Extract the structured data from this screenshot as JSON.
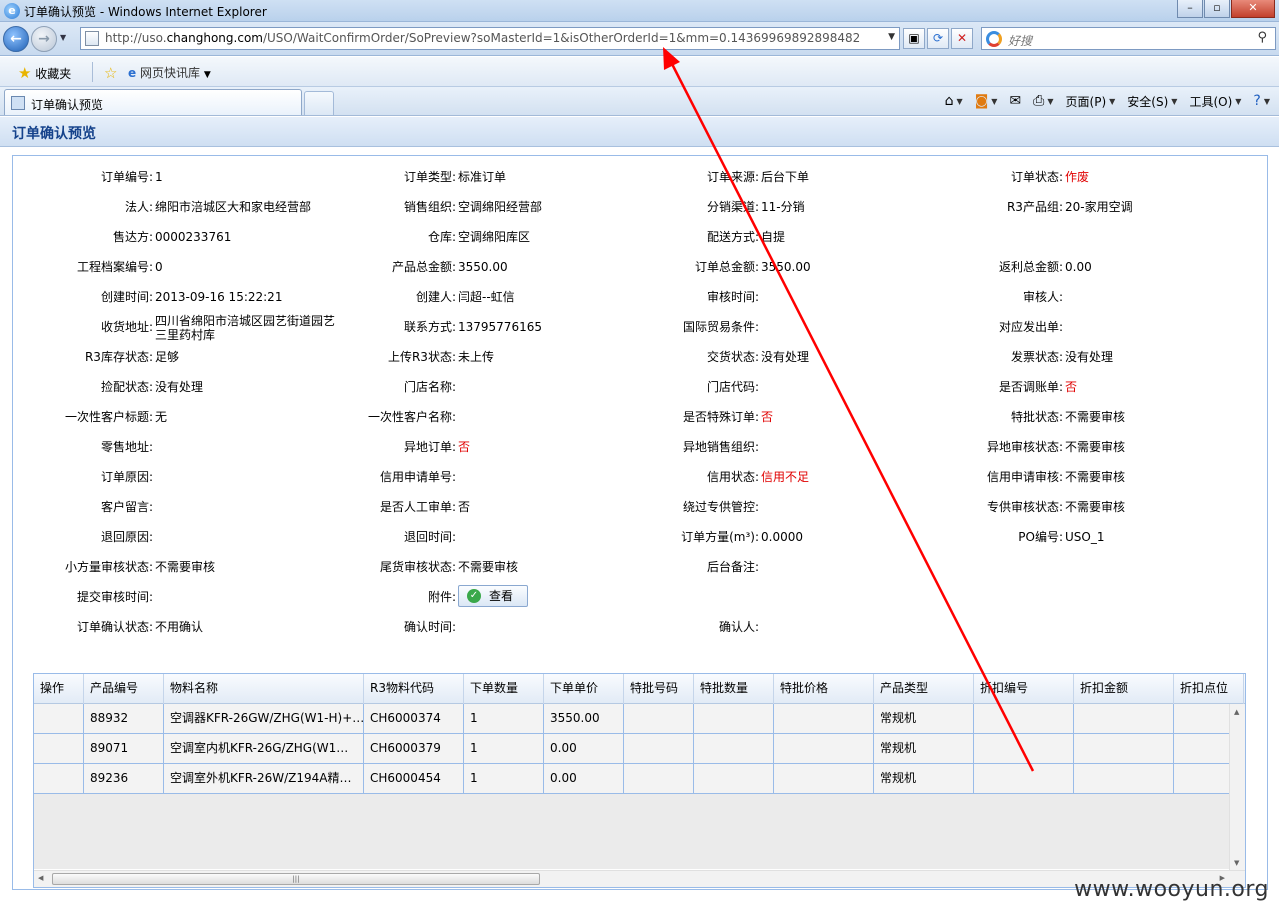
{
  "window": {
    "title": "订单确认预览 - Windows Internet Explorer"
  },
  "address": {
    "url_prefix": "http://uso.",
    "url_domain": "changhong.com",
    "url_suffix": "/USO/WaitConfirmOrder/SoPreview?soMasterId=1&isOtherOrderId=1&mm=0.14369969892898482",
    "search_placeholder": "好搜"
  },
  "favorites": {
    "favorites_label": "收藏夹",
    "quicklib_label": "网页快讯库"
  },
  "tabs": {
    "active_title": "订单确认预览"
  },
  "commandbar": {
    "page": "页面(P)",
    "safety": "安全(S)",
    "tools": "工具(O)"
  },
  "page": {
    "heading": "订单确认预览"
  },
  "form": {
    "rows": [
      [
        {
          "label": "订单编号:",
          "value": "1"
        },
        {
          "label": "订单类型:",
          "value": "标准订单"
        },
        {
          "label": "订单来源:",
          "value": "后台下单"
        },
        {
          "label": "订单状态:",
          "value": "作废",
          "red": true
        }
      ],
      [
        {
          "label": "法人:",
          "value": "绵阳市涪城区大和家电经营部"
        },
        {
          "label": "销售组织:",
          "value": "空调绵阳经营部"
        },
        {
          "label": "分销渠道:",
          "value": "11-分销"
        },
        {
          "label": "R3产品组:",
          "value": "20-家用空调"
        }
      ],
      [
        {
          "label": "售达方:",
          "value": "0000233761"
        },
        {
          "label": "仓库:",
          "value": "空调绵阳库区"
        },
        {
          "label": "配送方式:",
          "value": "自提"
        },
        {
          "label": "",
          "value": ""
        }
      ],
      [
        {
          "label": "工程档案编号:",
          "value": "0"
        },
        {
          "label": "产品总金额:",
          "value": "3550.00"
        },
        {
          "label": "订单总金额:",
          "value": "3550.00"
        },
        {
          "label": "返利总金额:",
          "value": "0.00"
        }
      ],
      [
        {
          "label": "创建时间:",
          "value": "2013-09-16 15:22:21"
        },
        {
          "label": "创建人:",
          "value": "闫超--虹信"
        },
        {
          "label": "审核时间:",
          "value": ""
        },
        {
          "label": "审核人:",
          "value": ""
        }
      ],
      [
        {
          "label": "收货地址:",
          "value": "四川省绵阳市涪城区园艺街道园艺",
          "value2": "三里药村库"
        },
        {
          "label": "联系方式:",
          "value": "13795776165"
        },
        {
          "label": "国际贸易条件:",
          "value": ""
        },
        {
          "label": "对应发出单:",
          "value": ""
        }
      ],
      [
        {
          "label": "R3库存状态:",
          "value": "足够"
        },
        {
          "label": "上传R3状态:",
          "value": "未上传"
        },
        {
          "label": "交货状态:",
          "value": "没有处理"
        },
        {
          "label": "发票状态:",
          "value": "没有处理"
        }
      ],
      [
        {
          "label": "捡配状态:",
          "value": "没有处理"
        },
        {
          "label": "门店名称:",
          "value": ""
        },
        {
          "label": "门店代码:",
          "value": ""
        },
        {
          "label": "是否调账单:",
          "value": "否",
          "red": true
        }
      ],
      [
        {
          "label": "一次性客户标题:",
          "value": "无"
        },
        {
          "label": "一次性客户名称:",
          "value": ""
        },
        {
          "label": "是否特殊订单:",
          "value": "否",
          "red": true
        },
        {
          "label": "特批状态:",
          "value": "不需要审核"
        }
      ],
      [
        {
          "label": "零售地址:",
          "value": ""
        },
        {
          "label": "异地订单:",
          "value": "否",
          "red": true
        },
        {
          "label": "异地销售组织:",
          "value": ""
        },
        {
          "label": "异地审核状态:",
          "value": "不需要审核"
        }
      ],
      [
        {
          "label": "订单原因:",
          "value": ""
        },
        {
          "label": "信用申请单号:",
          "value": ""
        },
        {
          "label": "信用状态:",
          "value": "信用不足",
          "red": true
        },
        {
          "label": "信用申请审核:",
          "value": "不需要审核"
        }
      ],
      [
        {
          "label": "客户留言:",
          "value": ""
        },
        {
          "label": "是否人工审单:",
          "value": "否"
        },
        {
          "label": "绕过专供管控:",
          "value": ""
        },
        {
          "label": "专供审核状态:",
          "value": "不需要审核"
        }
      ],
      [
        {
          "label": "退回原因:",
          "value": ""
        },
        {
          "label": "退回时间:",
          "value": ""
        },
        {
          "label": "订单方量(m³):",
          "value": "0.0000"
        },
        {
          "label": "PO编号:",
          "value": "USO_1"
        }
      ],
      [
        {
          "label": "小方量审核状态:",
          "value": "不需要审核"
        },
        {
          "label": "尾货审核状态:",
          "value": "不需要审核"
        },
        {
          "label": "后台备注:",
          "value": ""
        },
        {
          "label": "",
          "value": ""
        }
      ],
      [
        {
          "label": "提交审核时间:",
          "value": ""
        },
        {
          "label": "附件:",
          "value": "",
          "button": "查看"
        },
        {
          "label": "",
          "value": ""
        },
        {
          "label": "",
          "value": ""
        }
      ],
      [
        {
          "label": "订单确认状态:",
          "value": "不用确认"
        },
        {
          "label": "确认时间:",
          "value": ""
        },
        {
          "label": "确认人:",
          "value": ""
        },
        {
          "label": "",
          "value": ""
        }
      ]
    ]
  },
  "grid": {
    "columns": [
      "操作",
      "产品编号",
      "物料名称",
      "R3物料代码",
      "下单数量",
      "下单单价",
      "特批号码",
      "特批数量",
      "特批价格",
      "产品类型",
      "折扣编号",
      "折扣金额",
      "折扣点位"
    ],
    "rows": [
      [
        "",
        "88932",
        "空调器KFR-26GW/ZHG(W1-H)+…",
        "CH6000374",
        "1",
        "3550.00",
        "",
        "",
        "",
        "常规机",
        "",
        "",
        ""
      ],
      [
        "",
        "89071",
        "空调室内机KFR-26G/ZHG(W1…",
        "CH6000379",
        "1",
        "0.00",
        "",
        "",
        "",
        "常规机",
        "",
        "",
        ""
      ],
      [
        "",
        "89236",
        "空调室外机KFR-26W/Z194A精…",
        "CH6000454",
        "1",
        "0.00",
        "",
        "",
        "",
        "常规机",
        "",
        "",
        ""
      ]
    ]
  },
  "watermark": "www.wooyun.org",
  "colors": {
    "accent": "#15428b",
    "alert": "#e00000",
    "arrow": "#ff0000"
  }
}
